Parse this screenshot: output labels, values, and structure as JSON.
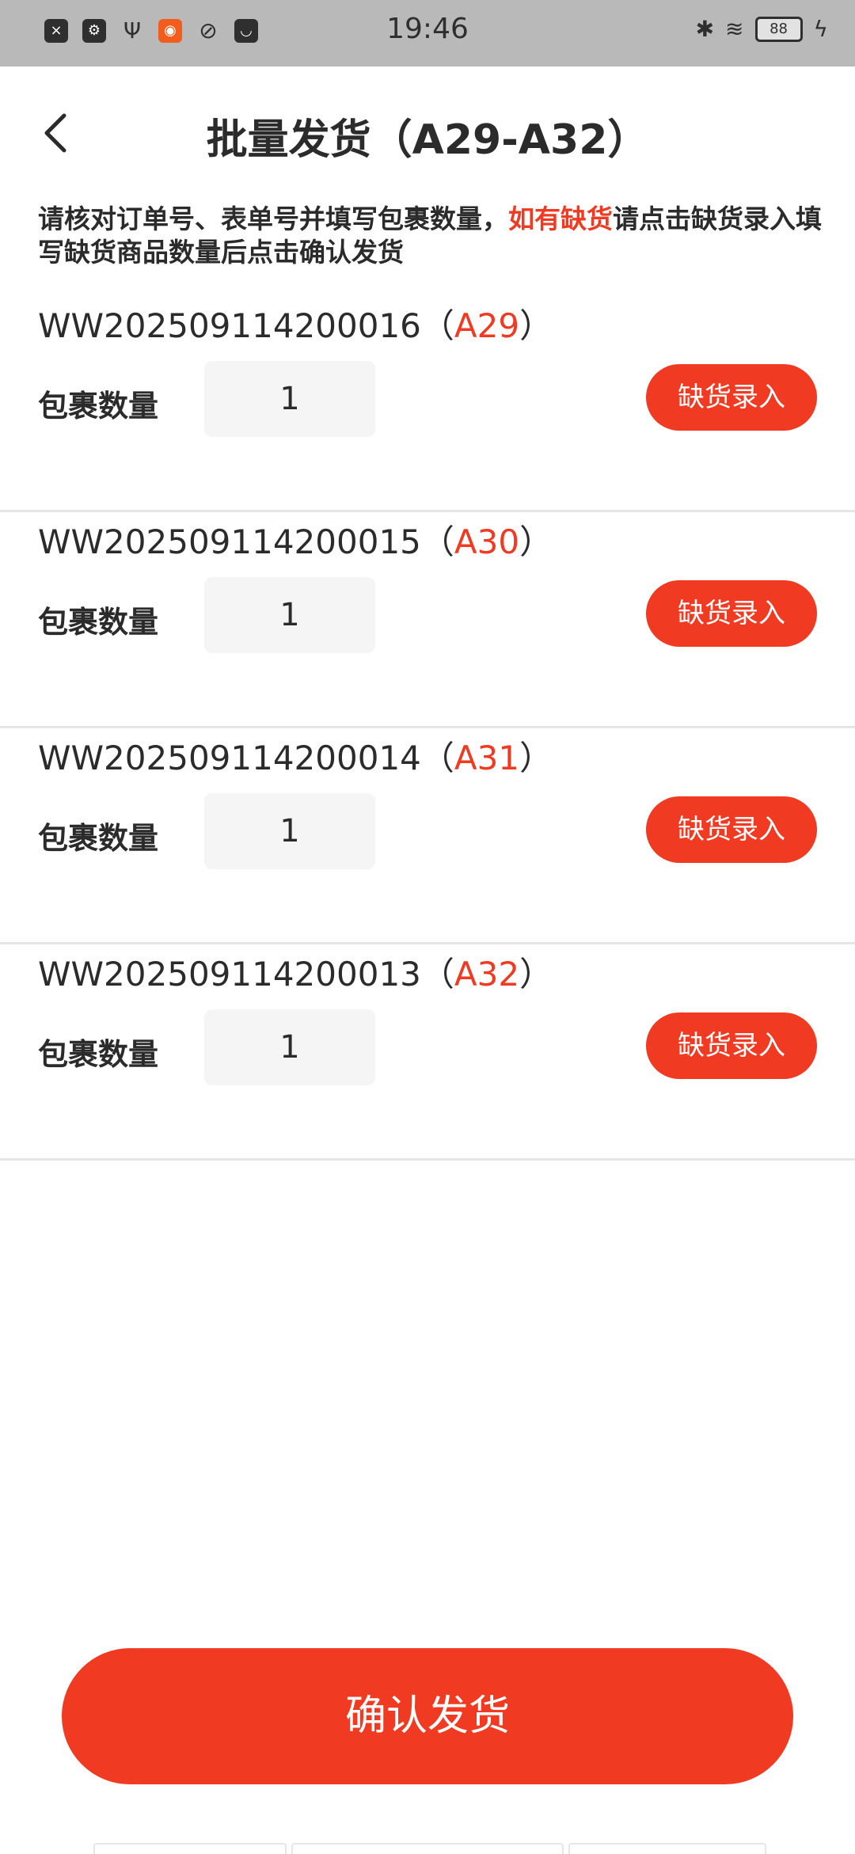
{
  "status_bar": {
    "time": "19:46",
    "battery": "88",
    "icons": [
      "sim-icon",
      "usb-debug-icon",
      "usb-icon",
      "app-notification-icon",
      "link-icon",
      "mail-icon",
      "bluetooth-icon",
      "wifi-icon",
      "battery-icon",
      "charging-icon"
    ]
  },
  "header": {
    "title": "批量发货（A29-A32）",
    "back_icon": "chevron-left-icon"
  },
  "notice": {
    "part1": "请核对订单号、表单号并填写包裹数量，",
    "highlight": "如有缺货",
    "part2": "请点击缺货录入填写缺货商品数量后点击确认发货",
    "highlight_color": "#f03a22"
  },
  "orders": [
    {
      "id": "WW202509114200016",
      "open": "（",
      "code": "A29",
      "close": "）",
      "qty_label": "包裹数量",
      "qty": "1",
      "button": "缺货录入"
    },
    {
      "id": "WW202509114200015",
      "open": "（",
      "code": "A30",
      "close": "）",
      "qty_label": "包裹数量",
      "qty": "1",
      "button": "缺货录入"
    },
    {
      "id": "WW202509114200014",
      "open": "（",
      "code": "A31",
      "close": "）",
      "qty_label": "包裹数量",
      "qty": "1",
      "button": "缺货录入"
    },
    {
      "id": "WW202509114200013",
      "open": "（",
      "code": "A32",
      "close": "）",
      "qty_label": "包裹数量",
      "qty": "1",
      "button": "缺货录入"
    }
  ],
  "confirm_button": "确认发货",
  "colors": {
    "accent": "#f03a22",
    "status_bar": "#b9b9b9",
    "input_bg": "#f5f5f5"
  }
}
